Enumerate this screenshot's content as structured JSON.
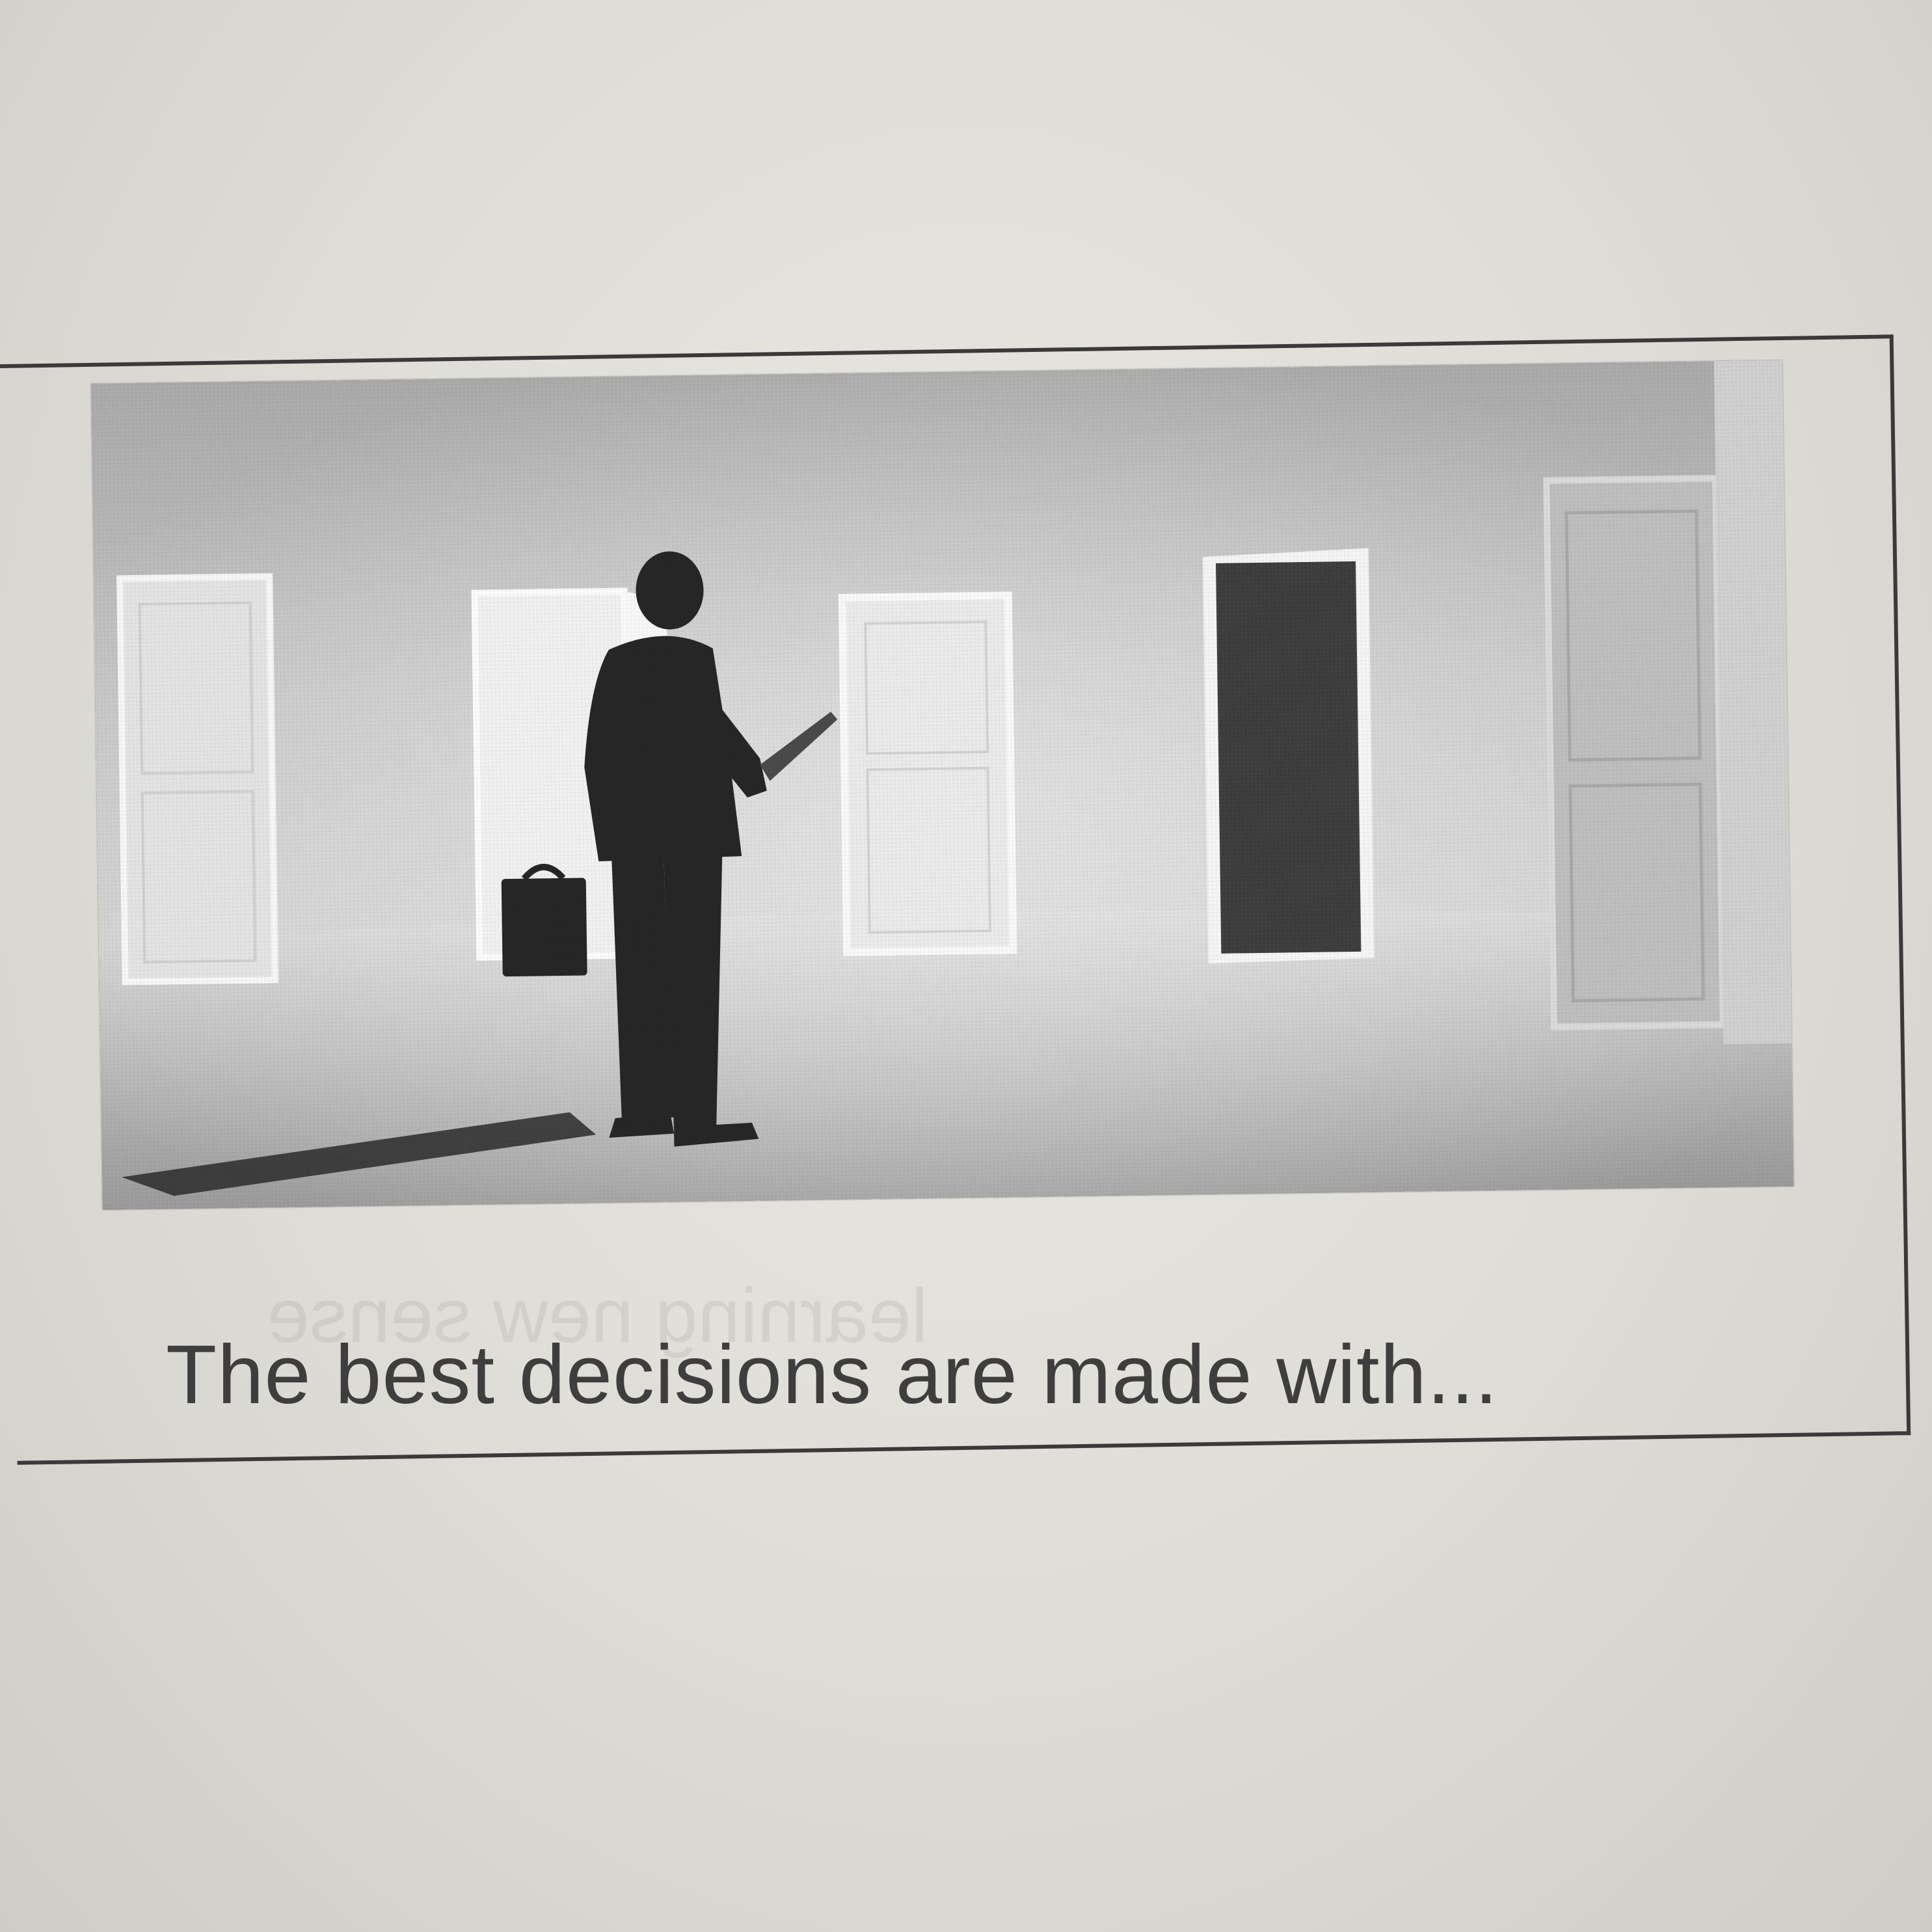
{
  "figure": {
    "caption": "The best decisions are made with..."
  }
}
